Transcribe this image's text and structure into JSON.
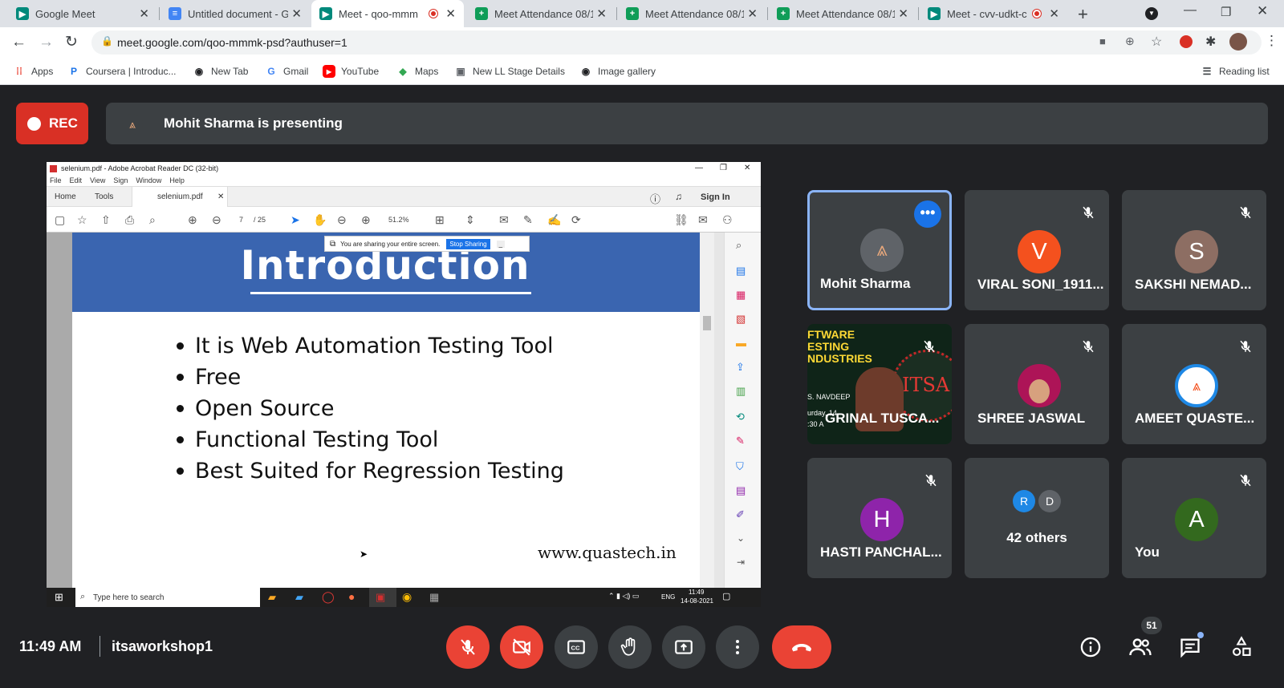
{
  "browser": {
    "tabs": [
      {
        "title": "Google Meet",
        "icon": "meet-icon",
        "active": false
      },
      {
        "title": "Untitled document - G",
        "icon": "docs-icon",
        "active": false
      },
      {
        "title": "Meet - qoo-mmm",
        "icon": "meet-icon",
        "active": true,
        "recording": true
      },
      {
        "title": "Meet Attendance 08/1",
        "icon": "sheets-icon",
        "active": false
      },
      {
        "title": "Meet Attendance 08/1",
        "icon": "sheets-icon",
        "active": false
      },
      {
        "title": "Meet Attendance 08/1",
        "icon": "sheets-icon",
        "active": false
      },
      {
        "title": "Meet - cvv-udkt-c",
        "icon": "meet-icon",
        "active": false,
        "recording": true
      }
    ],
    "url": "meet.google.com/qoo-mmmk-psd?authuser=1",
    "bookmarks": [
      {
        "label": "Apps",
        "icon": "apps-grid-icon"
      },
      {
        "label": "Coursera | Introduc...",
        "icon": "coursera-icon"
      },
      {
        "label": "New Tab",
        "icon": "globe-icon"
      },
      {
        "label": "Gmail",
        "icon": "google-icon"
      },
      {
        "label": "YouTube",
        "icon": "youtube-icon"
      },
      {
        "label": "Maps",
        "icon": "maps-icon"
      },
      {
        "label": "New LL Stage Details",
        "icon": "page-icon"
      },
      {
        "label": "Image gallery",
        "icon": "globe-icon"
      }
    ],
    "reading_list": "Reading list"
  },
  "meet": {
    "rec_label": "REC",
    "presenting_text": "Mohit Sharma is presenting",
    "time": "11:49 AM",
    "meeting_code": "itsaworkshop1",
    "participant_count": "51"
  },
  "acrobat": {
    "window_title": "selenium.pdf - Adobe Acrobat Reader DC (32-bit)",
    "menu": [
      "File",
      "Edit",
      "View",
      "Sign",
      "Window",
      "Help"
    ],
    "tab_home": "Home",
    "tab_tools": "Tools",
    "doc_tab": "selenium.pdf",
    "sign_in": "Sign In",
    "page_current": "7",
    "page_total": "/ 25",
    "zoom": "51.2%",
    "sharing_notice": "You are sharing your entire screen.",
    "stop_sharing": "Stop Sharing",
    "taskbar_search": "Type here to search",
    "tray_lang": "ENG",
    "tray_time": "11:49",
    "tray_date": "14-08-2021"
  },
  "slide": {
    "title": "Introduction",
    "bullets": [
      "It is Web Automation Testing Tool",
      "Free",
      "Open Source",
      "Functional Testing Tool",
      "Best Suited for Regression Testing"
    ],
    "website": "www.quastech.in"
  },
  "participants": [
    {
      "name": "Mohit Sharma",
      "initial": "",
      "color": "#5f6368",
      "muted": false,
      "active": true
    },
    {
      "name": "VIRAL SONI_1911...",
      "initial": "V",
      "color": "#f4511e",
      "muted": true
    },
    {
      "name": "SAKSHI NEMAD...",
      "initial": "S",
      "color": "#8d6e63",
      "muted": true
    },
    {
      "name": "GRINAL TUSCA...",
      "initial": "",
      "color": "",
      "muted": true,
      "video": true
    },
    {
      "name": "SHREE JASWAL",
      "initial": "",
      "color": "",
      "muted": true,
      "photo": true
    },
    {
      "name": "AMEET QUASTE...",
      "initial": "",
      "color": "#ffffff",
      "muted": true
    },
    {
      "name": "HASTI PANCHAL...",
      "initial": "H",
      "color": "#8e24aa",
      "muted": true
    },
    {
      "name": "42 others",
      "initial": "",
      "muted": false,
      "others": [
        "R",
        "D"
      ]
    },
    {
      "name": "You",
      "initial": "A",
      "color": "#33691e",
      "muted": true
    }
  ],
  "video_tile_text": [
    "FTWARE",
    "ESTING",
    "NDUSTRIES",
    "S. NAVDEEP",
    "urday, 14",
    ":30 A",
    "ITSA"
  ]
}
